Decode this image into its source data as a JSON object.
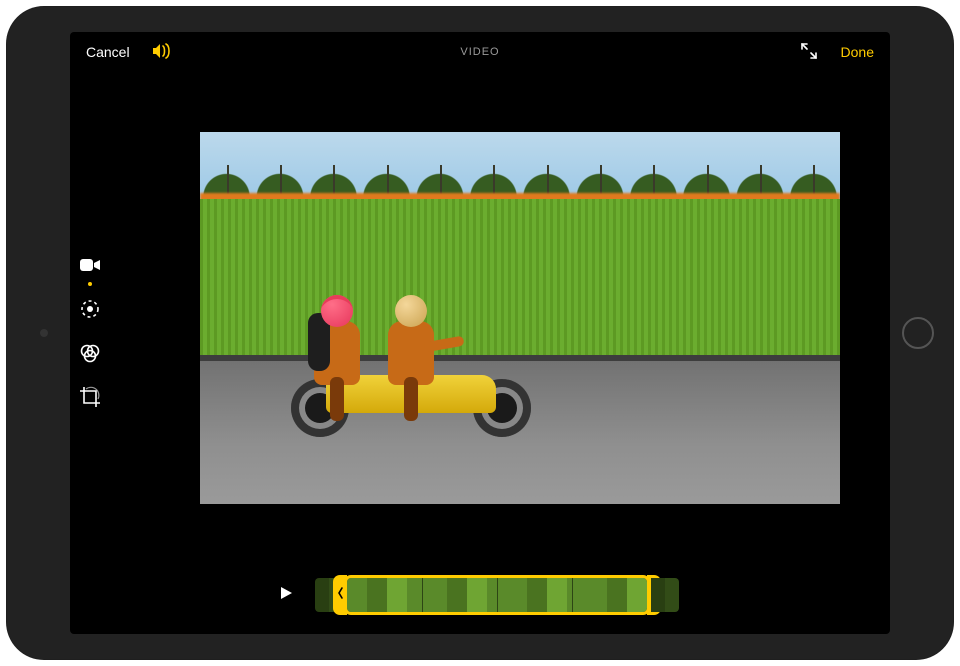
{
  "header": {
    "cancel_label": "Cancel",
    "title": "VIDEO",
    "done_label": "Done"
  },
  "colors": {
    "accent": "#ffcc00"
  },
  "tools": {
    "video": {
      "name": "video",
      "active": true
    },
    "adjust": {
      "name": "adjust",
      "active": false
    },
    "filters": {
      "name": "filters",
      "active": false
    },
    "crop": {
      "name": "crop",
      "active": false
    }
  },
  "timeline": {
    "frame_count": 4
  }
}
